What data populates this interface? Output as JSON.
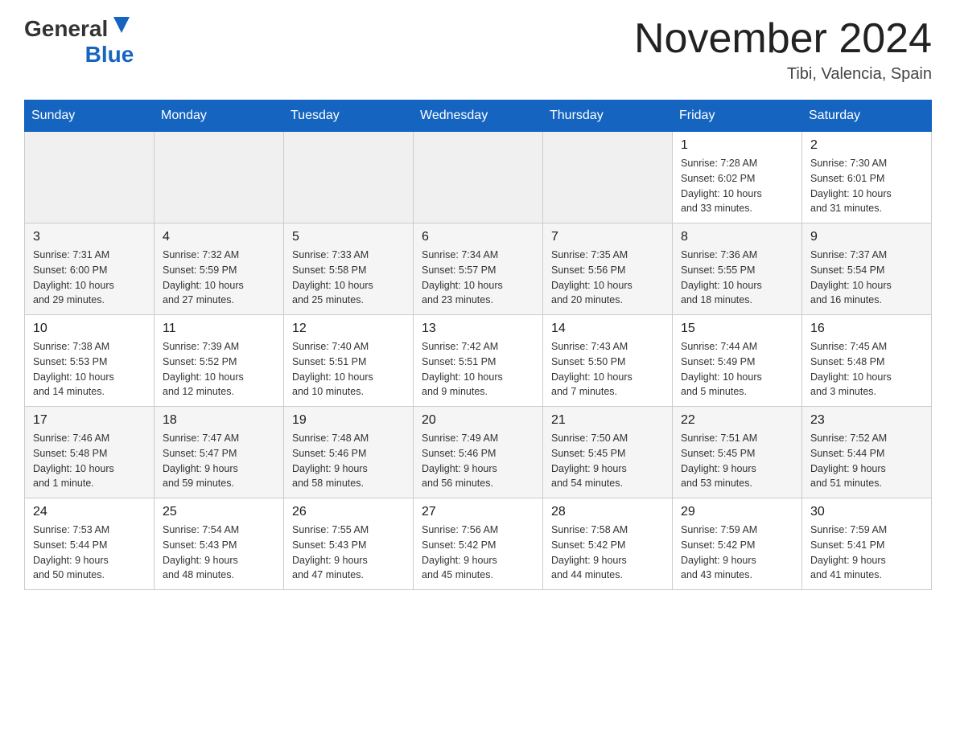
{
  "header": {
    "logo_general": "General",
    "logo_blue": "Blue",
    "month_title": "November 2024",
    "location": "Tibi, Valencia, Spain"
  },
  "weekdays": [
    "Sunday",
    "Monday",
    "Tuesday",
    "Wednesday",
    "Thursday",
    "Friday",
    "Saturday"
  ],
  "weeks": [
    [
      {
        "day": "",
        "info": ""
      },
      {
        "day": "",
        "info": ""
      },
      {
        "day": "",
        "info": ""
      },
      {
        "day": "",
        "info": ""
      },
      {
        "day": "",
        "info": ""
      },
      {
        "day": "1",
        "info": "Sunrise: 7:28 AM\nSunset: 6:02 PM\nDaylight: 10 hours\nand 33 minutes."
      },
      {
        "day": "2",
        "info": "Sunrise: 7:30 AM\nSunset: 6:01 PM\nDaylight: 10 hours\nand 31 minutes."
      }
    ],
    [
      {
        "day": "3",
        "info": "Sunrise: 7:31 AM\nSunset: 6:00 PM\nDaylight: 10 hours\nand 29 minutes."
      },
      {
        "day": "4",
        "info": "Sunrise: 7:32 AM\nSunset: 5:59 PM\nDaylight: 10 hours\nand 27 minutes."
      },
      {
        "day": "5",
        "info": "Sunrise: 7:33 AM\nSunset: 5:58 PM\nDaylight: 10 hours\nand 25 minutes."
      },
      {
        "day": "6",
        "info": "Sunrise: 7:34 AM\nSunset: 5:57 PM\nDaylight: 10 hours\nand 23 minutes."
      },
      {
        "day": "7",
        "info": "Sunrise: 7:35 AM\nSunset: 5:56 PM\nDaylight: 10 hours\nand 20 minutes."
      },
      {
        "day": "8",
        "info": "Sunrise: 7:36 AM\nSunset: 5:55 PM\nDaylight: 10 hours\nand 18 minutes."
      },
      {
        "day": "9",
        "info": "Sunrise: 7:37 AM\nSunset: 5:54 PM\nDaylight: 10 hours\nand 16 minutes."
      }
    ],
    [
      {
        "day": "10",
        "info": "Sunrise: 7:38 AM\nSunset: 5:53 PM\nDaylight: 10 hours\nand 14 minutes."
      },
      {
        "day": "11",
        "info": "Sunrise: 7:39 AM\nSunset: 5:52 PM\nDaylight: 10 hours\nand 12 minutes."
      },
      {
        "day": "12",
        "info": "Sunrise: 7:40 AM\nSunset: 5:51 PM\nDaylight: 10 hours\nand 10 minutes."
      },
      {
        "day": "13",
        "info": "Sunrise: 7:42 AM\nSunset: 5:51 PM\nDaylight: 10 hours\nand 9 minutes."
      },
      {
        "day": "14",
        "info": "Sunrise: 7:43 AM\nSunset: 5:50 PM\nDaylight: 10 hours\nand 7 minutes."
      },
      {
        "day": "15",
        "info": "Sunrise: 7:44 AM\nSunset: 5:49 PM\nDaylight: 10 hours\nand 5 minutes."
      },
      {
        "day": "16",
        "info": "Sunrise: 7:45 AM\nSunset: 5:48 PM\nDaylight: 10 hours\nand 3 minutes."
      }
    ],
    [
      {
        "day": "17",
        "info": "Sunrise: 7:46 AM\nSunset: 5:48 PM\nDaylight: 10 hours\nand 1 minute."
      },
      {
        "day": "18",
        "info": "Sunrise: 7:47 AM\nSunset: 5:47 PM\nDaylight: 9 hours\nand 59 minutes."
      },
      {
        "day": "19",
        "info": "Sunrise: 7:48 AM\nSunset: 5:46 PM\nDaylight: 9 hours\nand 58 minutes."
      },
      {
        "day": "20",
        "info": "Sunrise: 7:49 AM\nSunset: 5:46 PM\nDaylight: 9 hours\nand 56 minutes."
      },
      {
        "day": "21",
        "info": "Sunrise: 7:50 AM\nSunset: 5:45 PM\nDaylight: 9 hours\nand 54 minutes."
      },
      {
        "day": "22",
        "info": "Sunrise: 7:51 AM\nSunset: 5:45 PM\nDaylight: 9 hours\nand 53 minutes."
      },
      {
        "day": "23",
        "info": "Sunrise: 7:52 AM\nSunset: 5:44 PM\nDaylight: 9 hours\nand 51 minutes."
      }
    ],
    [
      {
        "day": "24",
        "info": "Sunrise: 7:53 AM\nSunset: 5:44 PM\nDaylight: 9 hours\nand 50 minutes."
      },
      {
        "day": "25",
        "info": "Sunrise: 7:54 AM\nSunset: 5:43 PM\nDaylight: 9 hours\nand 48 minutes."
      },
      {
        "day": "26",
        "info": "Sunrise: 7:55 AM\nSunset: 5:43 PM\nDaylight: 9 hours\nand 47 minutes."
      },
      {
        "day": "27",
        "info": "Sunrise: 7:56 AM\nSunset: 5:42 PM\nDaylight: 9 hours\nand 45 minutes."
      },
      {
        "day": "28",
        "info": "Sunrise: 7:58 AM\nSunset: 5:42 PM\nDaylight: 9 hours\nand 44 minutes."
      },
      {
        "day": "29",
        "info": "Sunrise: 7:59 AM\nSunset: 5:42 PM\nDaylight: 9 hours\nand 43 minutes."
      },
      {
        "day": "30",
        "info": "Sunrise: 7:59 AM\nSunset: 5:41 PM\nDaylight: 9 hours\nand 41 minutes."
      }
    ]
  ]
}
